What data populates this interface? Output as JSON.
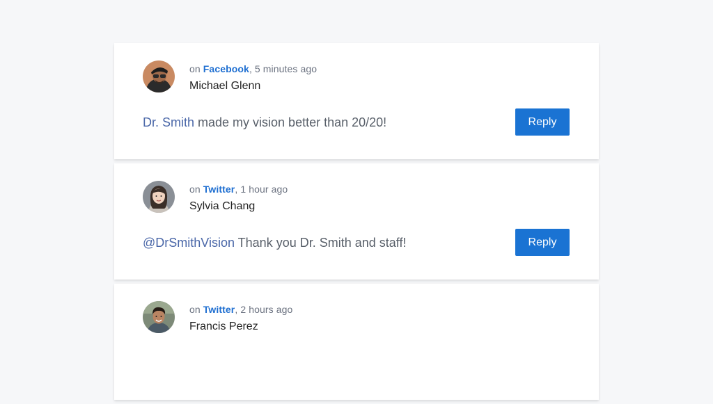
{
  "reviews": [
    {
      "prefix": "on",
      "platform": "Facebook",
      "time": ", 5 minutes ago",
      "author": "Michael Glenn",
      "message_lead": "Dr. Smith",
      "message_rest": " made my vision better than 20/20!",
      "reply_label": "Reply"
    },
    {
      "prefix": "on",
      "platform": "Twitter",
      "time": ", 1 hour ago",
      "author": "Sylvia Chang",
      "message_lead": "@DrSmithVision",
      "message_rest": " Thank you Dr. Smith and staff!",
      "reply_label": "Reply"
    },
    {
      "prefix": "on",
      "platform": "Twitter",
      "time": ", 2 hours ago",
      "author": "Francis Perez",
      "message_lead": "",
      "message_rest": "",
      "reply_label": ""
    }
  ],
  "colors": {
    "accent": "#1a73d3",
    "platform_link": "#1f6fd1",
    "message_lead": "#4a67a8",
    "page_background": "#f6f7f9"
  }
}
